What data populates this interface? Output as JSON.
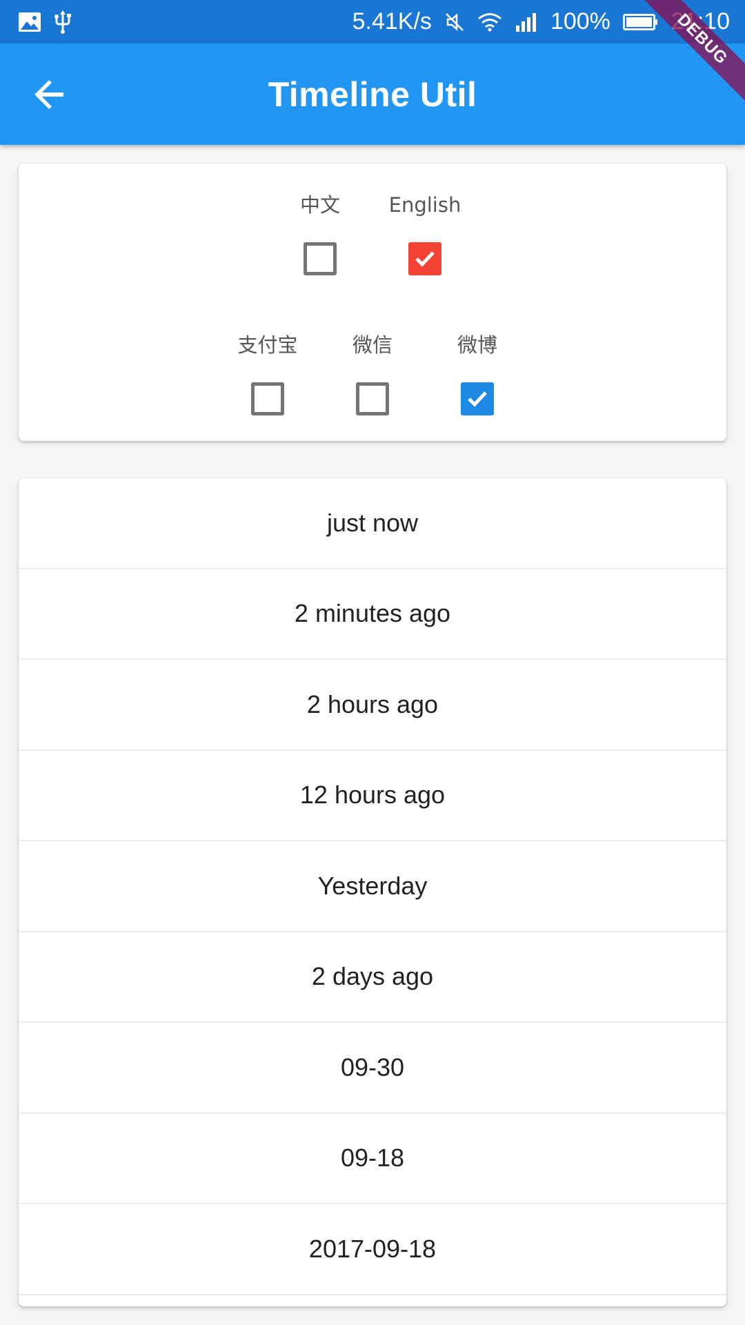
{
  "status_bar": {
    "network_speed": "5.41K/s",
    "battery": "100%",
    "time": "21:10",
    "icons": [
      "image-icon",
      "usb-icon",
      "mute-icon",
      "wifi-icon",
      "signal-icon",
      "battery-icon"
    ]
  },
  "app_bar": {
    "title": "Timeline Util",
    "back_icon": "arrow-back-icon",
    "debug_label": "DEBUG"
  },
  "colors": {
    "app_bar": "#2196f3",
    "status_bar": "#1976d2",
    "checked_red": "#f44336",
    "checked_blue": "#1e88e5"
  },
  "languages": [
    {
      "label": "中文",
      "checked": false
    },
    {
      "label": "English",
      "checked": true
    }
  ],
  "platforms": [
    {
      "label": "支付宝",
      "checked": false
    },
    {
      "label": "微信",
      "checked": false
    },
    {
      "label": "微博",
      "checked": true
    }
  ],
  "timeline": [
    "just now",
    "2 minutes ago",
    "2 hours ago",
    "12 hours ago",
    "Yesterday",
    "2 days ago",
    "09-30",
    "09-18",
    "2017-09-18"
  ]
}
